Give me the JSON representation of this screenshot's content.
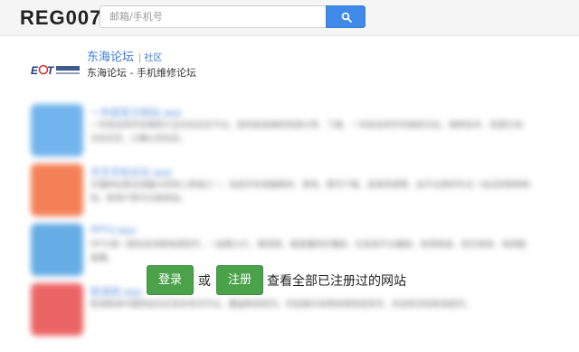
{
  "header": {
    "logo_text": "REG007",
    "search_placeholder": "邮箱/手机号",
    "search_icon": "search-icon"
  },
  "site": {
    "name": "东海论坛",
    "tag": "社区",
    "description": "东海论坛 - 手机维修论坛",
    "logo_icon": "ect-logo"
  },
  "blurred_list": [
    {
      "icon_color": "#5aa8ea",
      "title": "一年级官方网站.app",
      "text": "一年级全网手机维修大全论坛社区平台，提供各类维修资源分享、下载、一年级全网手机维修论坛，维修技术、资源交流、论坛社区，已确认的社区。"
    },
    {
      "icon_color": "#f26b3a",
      "title": "天天手机论坛.app",
      "text": "天猫网站是全球最大的网上商城之一，包括手机电脑数码、家电、图书下载、各类资源等，由平台提供专业一站式的购物体验，新用户即可注册网站。"
    },
    {
      "icon_color": "#4b9fe0",
      "title": "PPTV.app",
      "text": "PPTV是一款知名网络电视软件，一起看大片，看视频、看直播同步播放，在各类平台播放，体育频道、综艺频道，电视剧直播。"
    },
    {
      "icon_color": "#e94b4b",
      "title": "新浪网.app",
      "text": "新浪新闻中国网站社区综合资讯平台，覆盖新闻资讯，科技娱乐体育体育财经资讯，欢迎您浏览新浪首页。"
    }
  ],
  "cta": {
    "login_label": "登录",
    "or_label": "或",
    "register_label": "注册",
    "text": "查看全部已注册过的网站"
  },
  "colors": {
    "accent_blue": "#3f89e8",
    "button_green": "#4ba24b",
    "link_blue": "#3a7bd5"
  }
}
